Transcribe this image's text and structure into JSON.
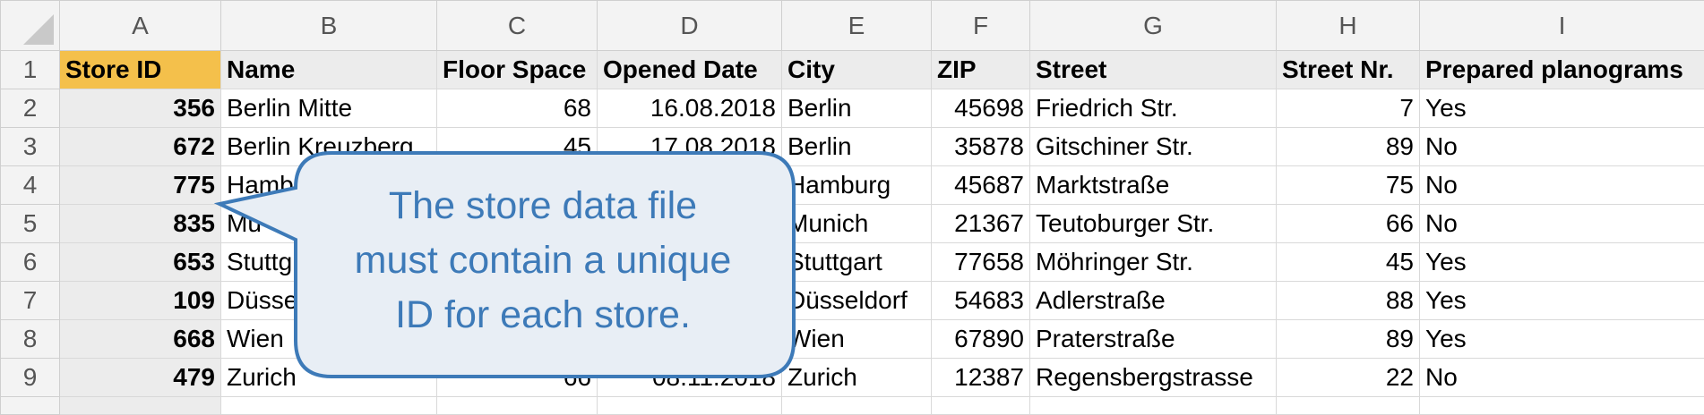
{
  "spreadsheet": {
    "column_letters": [
      "A",
      "B",
      "C",
      "D",
      "E",
      "F",
      "G",
      "H",
      "I"
    ],
    "row_numbers": [
      "1",
      "2",
      "3",
      "4",
      "5",
      "6",
      "7",
      "8",
      "9"
    ],
    "headers": [
      "Store ID",
      "Name",
      "Floor Space",
      "Opened Date",
      "City",
      "ZIP",
      "Street",
      "Street Nr.",
      "Prepared planograms"
    ],
    "rows": [
      [
        "356",
        "Berlin Mitte",
        "68",
        "16.08.2018",
        "Berlin",
        "45698",
        "Friedrich Str.",
        "7",
        "Yes"
      ],
      [
        "672",
        "Berlin Kreuzberg",
        "45",
        "17.08.2018",
        "Berlin",
        "35878",
        "Gitschiner Str.",
        "89",
        "No"
      ],
      [
        "775",
        "Hamb",
        "",
        "",
        "Hamburg",
        "45687",
        "Marktstraße",
        "75",
        "No"
      ],
      [
        "835",
        "Mu",
        "",
        "",
        "Munich",
        "21367",
        "Teutoburger Str.",
        "66",
        "No"
      ],
      [
        "653",
        "Stuttg",
        "",
        "",
        "Stuttgart",
        "77658",
        "Möhringer Str.",
        "45",
        "Yes"
      ],
      [
        "109",
        "Düsse",
        "",
        "",
        "Düsseldorf",
        "54683",
        "Adlerstraße",
        "88",
        "Yes"
      ],
      [
        "668",
        "Wien",
        "",
        "",
        "Wien",
        "67890",
        "Praterstraße",
        "89",
        "Yes"
      ],
      [
        "479",
        "Zurich",
        "66",
        "08.11.2018",
        "Zurich",
        "12387",
        "Regensbergstrasse",
        "22",
        "No"
      ]
    ]
  },
  "callout": {
    "line1": "The store data file",
    "line2": "must contain a unique",
    "line3": "ID for each store.",
    "text_color": "#3d7ab8",
    "border_color": "#3d7ab8",
    "fill_color": "#e8eef5"
  },
  "colors": {
    "header_highlight": "#f4c04b",
    "header_background": "#f3f3f3"
  }
}
